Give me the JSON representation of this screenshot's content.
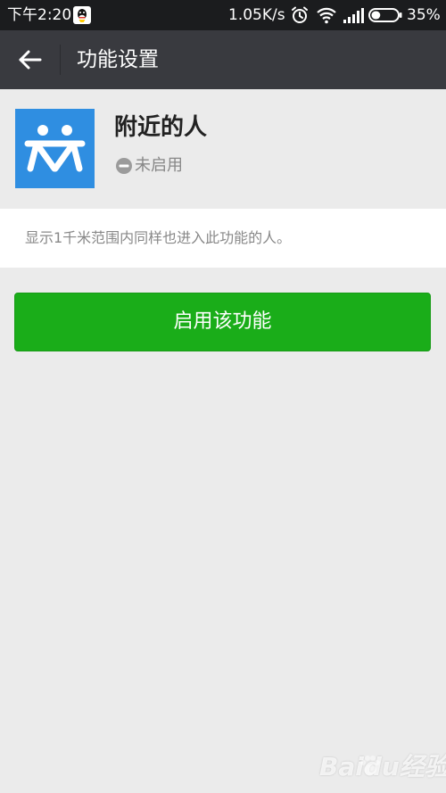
{
  "status_bar": {
    "time": "下午2:20",
    "network_speed": "1.05K/s",
    "battery_percent": "35%",
    "battery_level": 0.35,
    "icons": [
      "qq-icon",
      "alarm-icon",
      "wifi-icon",
      "signal-icon",
      "battery-icon"
    ]
  },
  "nav": {
    "back_icon": "back-arrow-icon",
    "title": "功能设置"
  },
  "feature": {
    "name": "附近的人",
    "status": "未启用",
    "status_icon": "disabled-icon",
    "logo_icon": "people-nearby-icon",
    "accent_color": "#2f8ee1"
  },
  "description": {
    "text": "显示1千米范围内同样也进入此功能的人。"
  },
  "actions": {
    "enable_label": "启用该功能",
    "button_color": "#1aad19"
  },
  "watermark": {
    "text": "Baidu经验"
  }
}
